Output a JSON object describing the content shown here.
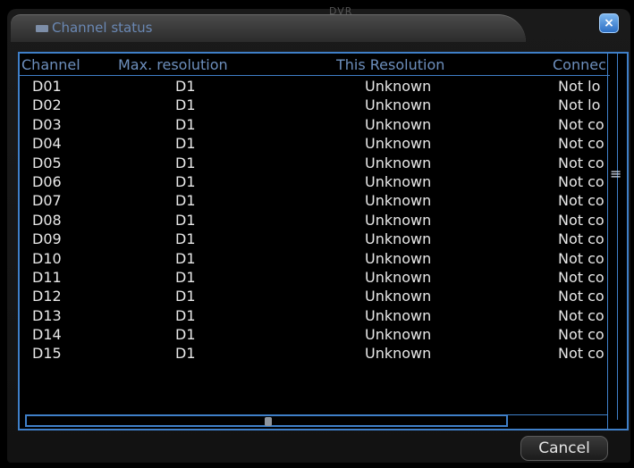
{
  "window": {
    "title": "Channel status",
    "topbar_hint": "DVR",
    "close_label": "×"
  },
  "table": {
    "headers": {
      "channel": "Channel",
      "max_resolution": "Max. resolution",
      "this_resolution": "This Resolution",
      "connection": "Connec"
    },
    "rows": [
      {
        "channel": "D01",
        "max": "D1",
        "this": "Unknown",
        "conn": "Not lo"
      },
      {
        "channel": "D02",
        "max": "D1",
        "this": "Unknown",
        "conn": "Not lo"
      },
      {
        "channel": "D03",
        "max": "D1",
        "this": "Unknown",
        "conn": "Not co"
      },
      {
        "channel": "D04",
        "max": "D1",
        "this": "Unknown",
        "conn": "Not co"
      },
      {
        "channel": "D05",
        "max": "D1",
        "this": "Unknown",
        "conn": "Not co"
      },
      {
        "channel": "D06",
        "max": "D1",
        "this": "Unknown",
        "conn": "Not co"
      },
      {
        "channel": "D07",
        "max": "D1",
        "this": "Unknown",
        "conn": "Not co"
      },
      {
        "channel": "D08",
        "max": "D1",
        "this": "Unknown",
        "conn": "Not co"
      },
      {
        "channel": "D09",
        "max": "D1",
        "this": "Unknown",
        "conn": "Not co"
      },
      {
        "channel": "D10",
        "max": "D1",
        "this": "Unknown",
        "conn": "Not co"
      },
      {
        "channel": "D11",
        "max": "D1",
        "this": "Unknown",
        "conn": "Not co"
      },
      {
        "channel": "D12",
        "max": "D1",
        "this": "Unknown",
        "conn": "Not co"
      },
      {
        "channel": "D13",
        "max": "D1",
        "this": "Unknown",
        "conn": "Not co"
      },
      {
        "channel": "D14",
        "max": "D1",
        "this": "Unknown",
        "conn": "Not co"
      },
      {
        "channel": "D15",
        "max": "D1",
        "this": "Unknown",
        "conn": "Not co"
      }
    ]
  },
  "scrollbar": {
    "vertical_thumb_glyph": "≡"
  },
  "buttons": {
    "cancel": "Cancel"
  },
  "colors": {
    "accent_blue": "#3f7fc8",
    "header_text": "#6d8fbd",
    "row_text": "#e8e8e8"
  }
}
